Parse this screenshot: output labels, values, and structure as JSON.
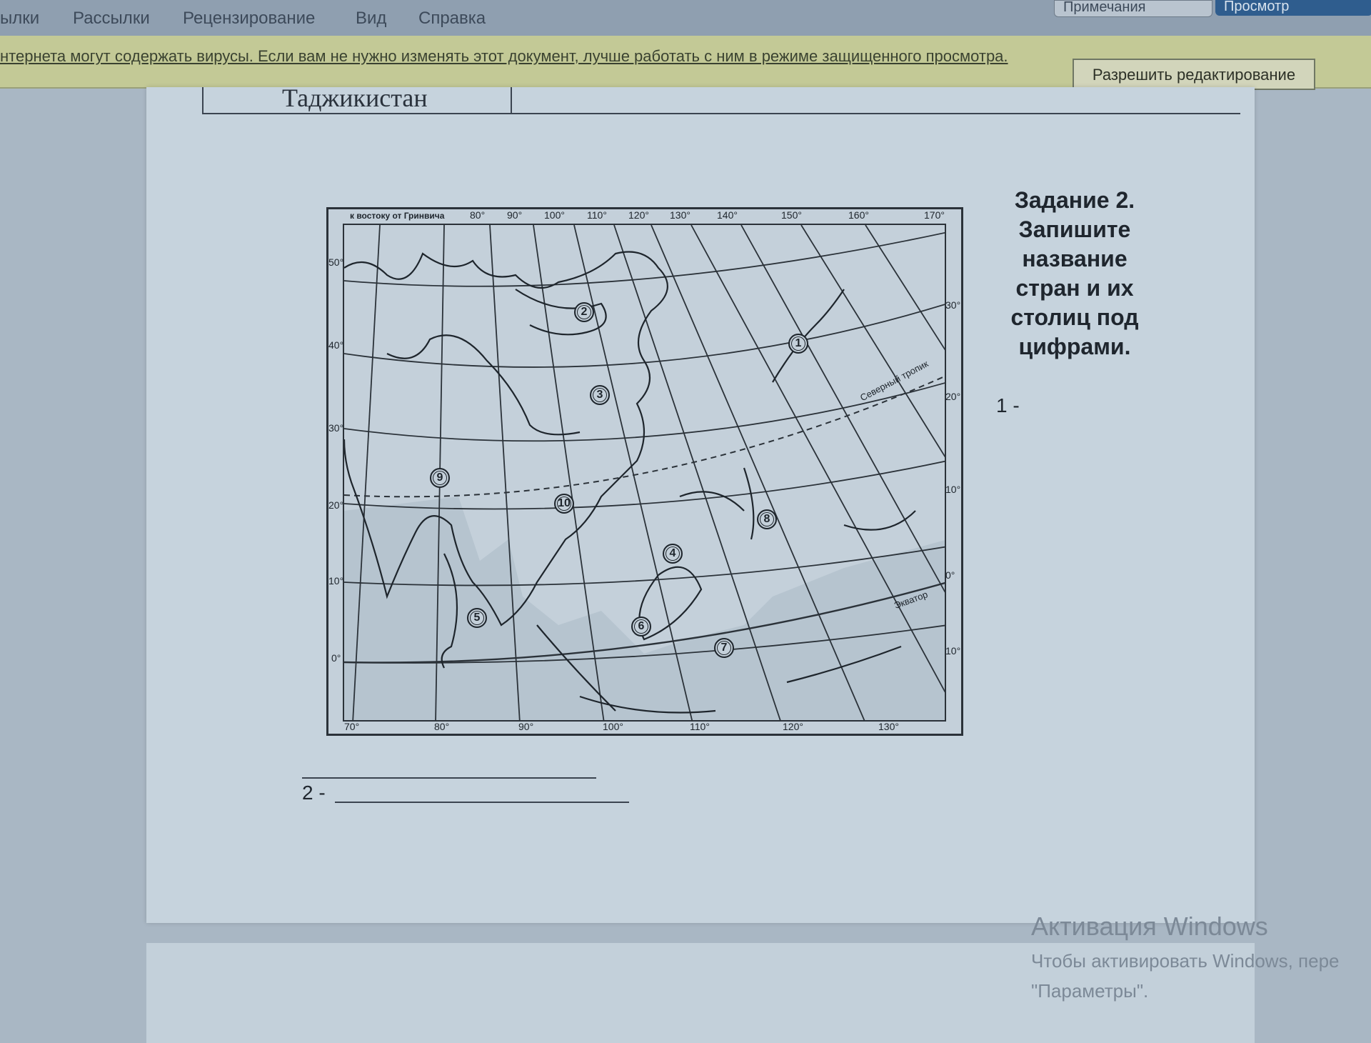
{
  "ribbon": {
    "tabs": [
      "ылки",
      "Рассылки",
      "Рецензирование",
      "Вид",
      "Справка"
    ],
    "comments_button": "Примечания",
    "share_button": "Просмотр"
  },
  "protected_view": {
    "message": "нтернета могут содержать вирусы. Если вам не нужно изменять этот документ, лучше работать с ним в режиме защищенного просмотра.",
    "enable_button": "Разрешить редактирование"
  },
  "document": {
    "table_cell_country": "Таджикистан",
    "task": {
      "lines": [
        "Задание 2.",
        "Запишите",
        "название",
        "стран и их",
        "столиц под",
        "цифрами."
      ]
    },
    "answer_1": "1 -",
    "answer_2": "2 -",
    "map": {
      "top_axis_note": "к востоку от Гринвича",
      "top_longitudes": [
        "80°",
        "90°",
        "100°",
        "110°",
        "120°",
        "130°",
        "140°",
        "150°",
        "160°",
        "170°"
      ],
      "bottom_longitudes": [
        "70°",
        "80°",
        "90°",
        "100°",
        "110°",
        "120°",
        "130°"
      ],
      "left_latitudes": [
        "50°",
        "40°",
        "30°",
        "20°",
        "10°",
        "0°"
      ],
      "right_latitudes": [
        "30°",
        "20°",
        "10°",
        "0°",
        "10°"
      ],
      "tropic_label": "Северный тропик",
      "equator_label": "Экватор",
      "markers": [
        "1",
        "2",
        "3",
        "4",
        "5",
        "6",
        "7",
        "8",
        "9",
        "10"
      ]
    }
  },
  "windows_watermark": {
    "title": "Активация Windows",
    "line1": "Чтобы активировать Windows, пере",
    "line2": "\"Параметры\"."
  }
}
